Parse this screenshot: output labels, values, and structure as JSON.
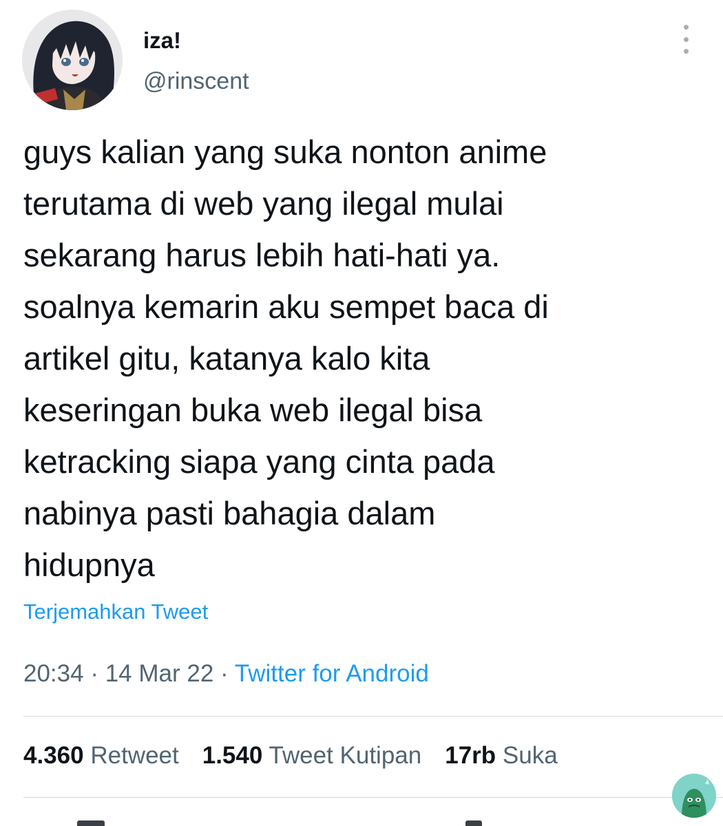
{
  "tweet": {
    "author": {
      "display_name": "iza!",
      "handle": "@rinscent",
      "avatar_icon": "avatar-anime-girl-icon"
    },
    "text": "guys kalian yang suka nonton anime\nterutama di web yang ilegal mulai\nsekarang harus lebih hati-hati ya.\nsoalnya kemarin aku sempet baca di\nartikel gitu, katanya kalo kita\nkeseringan buka web ilegal bisa\nketracking siapa yang cinta pada\nnabinya pasti bahagia dalam\nhidupnya",
    "translate_label": "Terjemahkan Tweet",
    "time": "20:34",
    "date": "14 Mar 22",
    "separator": " · ",
    "source": "Twitter for Android"
  },
  "stats": [
    {
      "count": "4.360",
      "label": "Retweet"
    },
    {
      "count": "1.540",
      "label": "Tweet Kutipan"
    },
    {
      "count": "17rb",
      "label": "Suka"
    }
  ],
  "colors": {
    "link": "#1d9bf0",
    "secondary_text": "#536471",
    "primary_text": "#0f1419",
    "divider": "#cfd9de"
  },
  "icons": {
    "more": "more-vertical-icon",
    "fab": "floating-avatar-icon"
  }
}
